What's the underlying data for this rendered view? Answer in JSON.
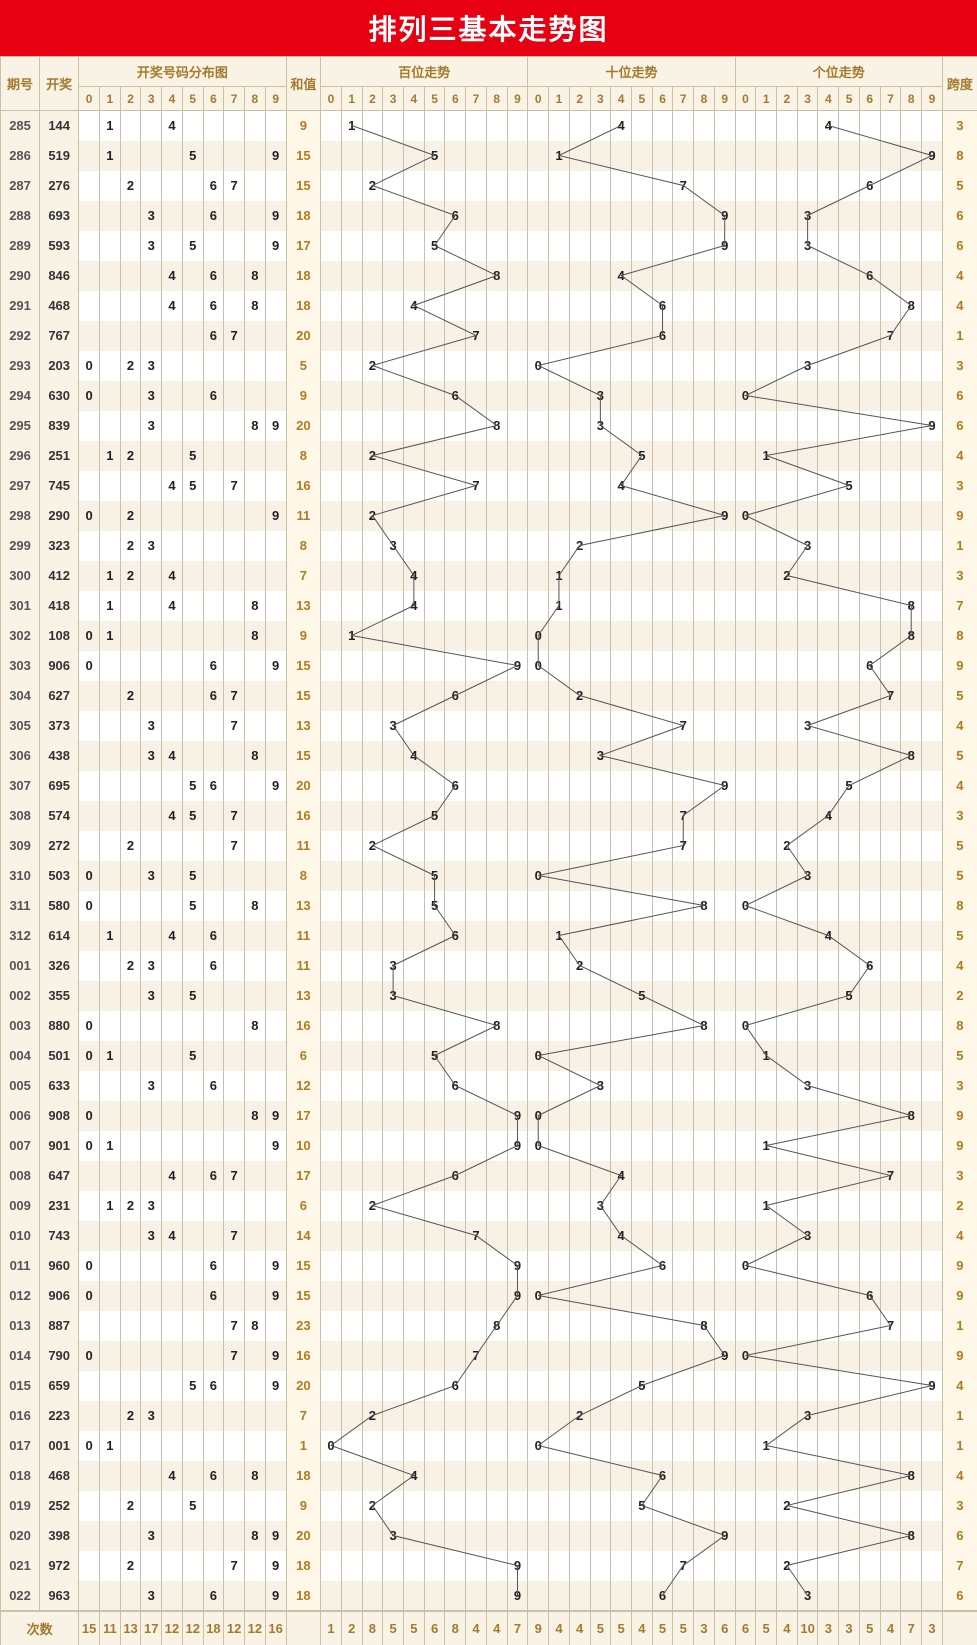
{
  "title": "排列三基本走势图",
  "headers": {
    "issue": "期号",
    "draw": "开奖",
    "dist": "开奖号码分布图",
    "sum": "和值",
    "h": "百位走势",
    "t": "十位走势",
    "o": "个位走势",
    "span": "跨度",
    "freq": "次数",
    "digits": [
      "0",
      "1",
      "2",
      "3",
      "4",
      "5",
      "6",
      "7",
      "8",
      "9"
    ]
  },
  "chart_data": {
    "type": "table",
    "title": "排列三基本走势图",
    "columns": [
      "期号",
      "开奖",
      "百位",
      "十位",
      "个位",
      "和值",
      "跨度"
    ],
    "rows": [
      {
        "issue": "285",
        "draw": "144",
        "h": 1,
        "t": 4,
        "o": 4,
        "sum": 9,
        "span": 3
      },
      {
        "issue": "286",
        "draw": "519",
        "h": 5,
        "t": 1,
        "o": 9,
        "sum": 15,
        "span": 8
      },
      {
        "issue": "287",
        "draw": "276",
        "h": 2,
        "t": 7,
        "o": 6,
        "sum": 15,
        "span": 5
      },
      {
        "issue": "288",
        "draw": "693",
        "h": 6,
        "t": 9,
        "o": 3,
        "sum": 18,
        "span": 6
      },
      {
        "issue": "289",
        "draw": "593",
        "h": 5,
        "t": 9,
        "o": 3,
        "sum": 17,
        "span": 6
      },
      {
        "issue": "290",
        "draw": "846",
        "h": 8,
        "t": 4,
        "o": 6,
        "sum": 18,
        "span": 4
      },
      {
        "issue": "291",
        "draw": "468",
        "h": 4,
        "t": 6,
        "o": 8,
        "sum": 18,
        "span": 4
      },
      {
        "issue": "292",
        "draw": "767",
        "h": 7,
        "t": 6,
        "o": 7,
        "sum": 20,
        "span": 1
      },
      {
        "issue": "293",
        "draw": "203",
        "h": 2,
        "t": 0,
        "o": 3,
        "sum": 5,
        "span": 3
      },
      {
        "issue": "294",
        "draw": "630",
        "h": 6,
        "t": 3,
        "o": 0,
        "sum": 9,
        "span": 6
      },
      {
        "issue": "295",
        "draw": "839",
        "h": 8,
        "t": 3,
        "o": 9,
        "sum": 20,
        "span": 6
      },
      {
        "issue": "296",
        "draw": "251",
        "h": 2,
        "t": 5,
        "o": 1,
        "sum": 8,
        "span": 4
      },
      {
        "issue": "297",
        "draw": "745",
        "h": 7,
        "t": 4,
        "o": 5,
        "sum": 16,
        "span": 3
      },
      {
        "issue": "298",
        "draw": "290",
        "h": 2,
        "t": 9,
        "o": 0,
        "sum": 11,
        "span": 9
      },
      {
        "issue": "299",
        "draw": "323",
        "h": 3,
        "t": 2,
        "o": 3,
        "sum": 8,
        "span": 1
      },
      {
        "issue": "300",
        "draw": "412",
        "h": 4,
        "t": 1,
        "o": 2,
        "sum": 7,
        "span": 3
      },
      {
        "issue": "301",
        "draw": "418",
        "h": 4,
        "t": 1,
        "o": 8,
        "sum": 13,
        "span": 7
      },
      {
        "issue": "302",
        "draw": "108",
        "h": 1,
        "t": 0,
        "o": 8,
        "sum": 9,
        "span": 8
      },
      {
        "issue": "303",
        "draw": "906",
        "h": 9,
        "t": 0,
        "o": 6,
        "sum": 15,
        "span": 9
      },
      {
        "issue": "304",
        "draw": "627",
        "h": 6,
        "t": 2,
        "o": 7,
        "sum": 15,
        "span": 5
      },
      {
        "issue": "305",
        "draw": "373",
        "h": 3,
        "t": 7,
        "o": 3,
        "sum": 13,
        "span": 4
      },
      {
        "issue": "306",
        "draw": "438",
        "h": 4,
        "t": 3,
        "o": 8,
        "sum": 15,
        "span": 5
      },
      {
        "issue": "307",
        "draw": "695",
        "h": 6,
        "t": 9,
        "o": 5,
        "sum": 20,
        "span": 4
      },
      {
        "issue": "308",
        "draw": "574",
        "h": 5,
        "t": 7,
        "o": 4,
        "sum": 16,
        "span": 3
      },
      {
        "issue": "309",
        "draw": "272",
        "h": 2,
        "t": 7,
        "o": 2,
        "sum": 11,
        "span": 5
      },
      {
        "issue": "310",
        "draw": "503",
        "h": 5,
        "t": 0,
        "o": 3,
        "sum": 8,
        "span": 5
      },
      {
        "issue": "311",
        "draw": "580",
        "h": 5,
        "t": 8,
        "o": 0,
        "sum": 13,
        "span": 8
      },
      {
        "issue": "312",
        "draw": "614",
        "h": 6,
        "t": 1,
        "o": 4,
        "sum": 11,
        "span": 5
      },
      {
        "issue": "001",
        "draw": "326",
        "h": 3,
        "t": 2,
        "o": 6,
        "sum": 11,
        "span": 4
      },
      {
        "issue": "002",
        "draw": "355",
        "h": 3,
        "t": 5,
        "o": 5,
        "sum": 13,
        "span": 2
      },
      {
        "issue": "003",
        "draw": "880",
        "h": 8,
        "t": 8,
        "o": 0,
        "sum": 16,
        "span": 8
      },
      {
        "issue": "004",
        "draw": "501",
        "h": 5,
        "t": 0,
        "o": 1,
        "sum": 6,
        "span": 5
      },
      {
        "issue": "005",
        "draw": "633",
        "h": 6,
        "t": 3,
        "o": 3,
        "sum": 12,
        "span": 3
      },
      {
        "issue": "006",
        "draw": "908",
        "h": 9,
        "t": 0,
        "o": 8,
        "sum": 17,
        "span": 9
      },
      {
        "issue": "007",
        "draw": "901",
        "h": 9,
        "t": 0,
        "o": 1,
        "sum": 10,
        "span": 9
      },
      {
        "issue": "008",
        "draw": "647",
        "h": 6,
        "t": 4,
        "o": 7,
        "sum": 17,
        "span": 3
      },
      {
        "issue": "009",
        "draw": "231",
        "h": 2,
        "t": 3,
        "o": 1,
        "sum": 6,
        "span": 2
      },
      {
        "issue": "010",
        "draw": "743",
        "h": 7,
        "t": 4,
        "o": 3,
        "sum": 14,
        "span": 4
      },
      {
        "issue": "011",
        "draw": "960",
        "h": 9,
        "t": 6,
        "o": 0,
        "sum": 15,
        "span": 9
      },
      {
        "issue": "012",
        "draw": "906",
        "h": 9,
        "t": 0,
        "o": 6,
        "sum": 15,
        "span": 9
      },
      {
        "issue": "013",
        "draw": "887",
        "h": 8,
        "t": 8,
        "o": 7,
        "sum": 23,
        "span": 1
      },
      {
        "issue": "014",
        "draw": "790",
        "h": 7,
        "t": 9,
        "o": 0,
        "sum": 16,
        "span": 9
      },
      {
        "issue": "015",
        "draw": "659",
        "h": 6,
        "t": 5,
        "o": 9,
        "sum": 20,
        "span": 4
      },
      {
        "issue": "016",
        "draw": "223",
        "h": 2,
        "t": 2,
        "o": 3,
        "sum": 7,
        "span": 1
      },
      {
        "issue": "017",
        "draw": "001",
        "h": 0,
        "t": 0,
        "o": 1,
        "sum": 1,
        "span": 1
      },
      {
        "issue": "018",
        "draw": "468",
        "h": 4,
        "t": 6,
        "o": 8,
        "sum": 18,
        "span": 4
      },
      {
        "issue": "019",
        "draw": "252",
        "h": 2,
        "t": 5,
        "o": 2,
        "sum": 9,
        "span": 3
      },
      {
        "issue": "020",
        "draw": "398",
        "h": 3,
        "t": 9,
        "o": 8,
        "sum": 20,
        "span": 6
      },
      {
        "issue": "021",
        "draw": "972",
        "h": 9,
        "t": 7,
        "o": 2,
        "sum": 18,
        "span": 7
      },
      {
        "issue": "022",
        "draw": "963",
        "h": 9,
        "t": 6,
        "o": 3,
        "sum": 18,
        "span": 6
      }
    ],
    "freq": {
      "dist": [
        15,
        11,
        13,
        17,
        12,
        12,
        18,
        12,
        12,
        16
      ],
      "h": [
        1,
        2,
        8,
        5,
        5,
        6,
        8,
        4,
        4,
        7
      ],
      "t": [
        9,
        4,
        4,
        5,
        5,
        4,
        5,
        5,
        3,
        6
      ],
      "o": [
        6,
        5,
        4,
        10,
        3,
        3,
        5,
        4,
        7,
        3
      ]
    }
  }
}
